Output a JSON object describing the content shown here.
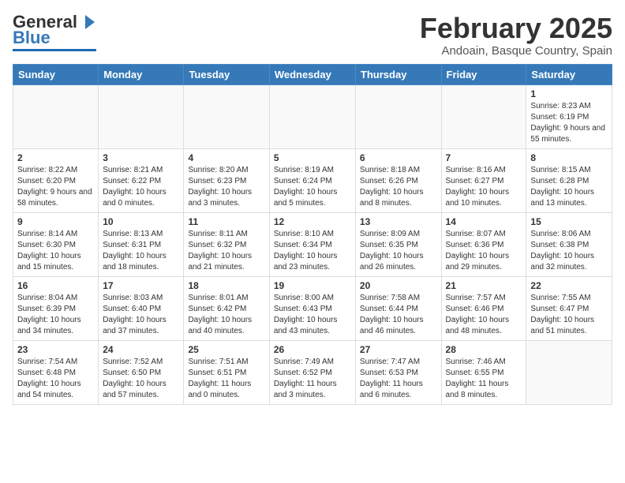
{
  "logo": {
    "line1": "General",
    "line2": "Blue"
  },
  "title": "February 2025",
  "subtitle": "Andoain, Basque Country, Spain",
  "weekdays": [
    "Sunday",
    "Monday",
    "Tuesday",
    "Wednesday",
    "Thursday",
    "Friday",
    "Saturday"
  ],
  "weeks": [
    [
      {
        "day": "",
        "info": ""
      },
      {
        "day": "",
        "info": ""
      },
      {
        "day": "",
        "info": ""
      },
      {
        "day": "",
        "info": ""
      },
      {
        "day": "",
        "info": ""
      },
      {
        "day": "",
        "info": ""
      },
      {
        "day": "1",
        "info": "Sunrise: 8:23 AM\nSunset: 6:19 PM\nDaylight: 9 hours and 55 minutes."
      }
    ],
    [
      {
        "day": "2",
        "info": "Sunrise: 8:22 AM\nSunset: 6:20 PM\nDaylight: 9 hours and 58 minutes."
      },
      {
        "day": "3",
        "info": "Sunrise: 8:21 AM\nSunset: 6:22 PM\nDaylight: 10 hours and 0 minutes."
      },
      {
        "day": "4",
        "info": "Sunrise: 8:20 AM\nSunset: 6:23 PM\nDaylight: 10 hours and 3 minutes."
      },
      {
        "day": "5",
        "info": "Sunrise: 8:19 AM\nSunset: 6:24 PM\nDaylight: 10 hours and 5 minutes."
      },
      {
        "day": "6",
        "info": "Sunrise: 8:18 AM\nSunset: 6:26 PM\nDaylight: 10 hours and 8 minutes."
      },
      {
        "day": "7",
        "info": "Sunrise: 8:16 AM\nSunset: 6:27 PM\nDaylight: 10 hours and 10 minutes."
      },
      {
        "day": "8",
        "info": "Sunrise: 8:15 AM\nSunset: 6:28 PM\nDaylight: 10 hours and 13 minutes."
      }
    ],
    [
      {
        "day": "9",
        "info": "Sunrise: 8:14 AM\nSunset: 6:30 PM\nDaylight: 10 hours and 15 minutes."
      },
      {
        "day": "10",
        "info": "Sunrise: 8:13 AM\nSunset: 6:31 PM\nDaylight: 10 hours and 18 minutes."
      },
      {
        "day": "11",
        "info": "Sunrise: 8:11 AM\nSunset: 6:32 PM\nDaylight: 10 hours and 21 minutes."
      },
      {
        "day": "12",
        "info": "Sunrise: 8:10 AM\nSunset: 6:34 PM\nDaylight: 10 hours and 23 minutes."
      },
      {
        "day": "13",
        "info": "Sunrise: 8:09 AM\nSunset: 6:35 PM\nDaylight: 10 hours and 26 minutes."
      },
      {
        "day": "14",
        "info": "Sunrise: 8:07 AM\nSunset: 6:36 PM\nDaylight: 10 hours and 29 minutes."
      },
      {
        "day": "15",
        "info": "Sunrise: 8:06 AM\nSunset: 6:38 PM\nDaylight: 10 hours and 32 minutes."
      }
    ],
    [
      {
        "day": "16",
        "info": "Sunrise: 8:04 AM\nSunset: 6:39 PM\nDaylight: 10 hours and 34 minutes."
      },
      {
        "day": "17",
        "info": "Sunrise: 8:03 AM\nSunset: 6:40 PM\nDaylight: 10 hours and 37 minutes."
      },
      {
        "day": "18",
        "info": "Sunrise: 8:01 AM\nSunset: 6:42 PM\nDaylight: 10 hours and 40 minutes."
      },
      {
        "day": "19",
        "info": "Sunrise: 8:00 AM\nSunset: 6:43 PM\nDaylight: 10 hours and 43 minutes."
      },
      {
        "day": "20",
        "info": "Sunrise: 7:58 AM\nSunset: 6:44 PM\nDaylight: 10 hours and 46 minutes."
      },
      {
        "day": "21",
        "info": "Sunrise: 7:57 AM\nSunset: 6:46 PM\nDaylight: 10 hours and 48 minutes."
      },
      {
        "day": "22",
        "info": "Sunrise: 7:55 AM\nSunset: 6:47 PM\nDaylight: 10 hours and 51 minutes."
      }
    ],
    [
      {
        "day": "23",
        "info": "Sunrise: 7:54 AM\nSunset: 6:48 PM\nDaylight: 10 hours and 54 minutes."
      },
      {
        "day": "24",
        "info": "Sunrise: 7:52 AM\nSunset: 6:50 PM\nDaylight: 10 hours and 57 minutes."
      },
      {
        "day": "25",
        "info": "Sunrise: 7:51 AM\nSunset: 6:51 PM\nDaylight: 11 hours and 0 minutes."
      },
      {
        "day": "26",
        "info": "Sunrise: 7:49 AM\nSunset: 6:52 PM\nDaylight: 11 hours and 3 minutes."
      },
      {
        "day": "27",
        "info": "Sunrise: 7:47 AM\nSunset: 6:53 PM\nDaylight: 11 hours and 6 minutes."
      },
      {
        "day": "28",
        "info": "Sunrise: 7:46 AM\nSunset: 6:55 PM\nDaylight: 11 hours and 8 minutes."
      },
      {
        "day": "",
        "info": ""
      }
    ]
  ]
}
